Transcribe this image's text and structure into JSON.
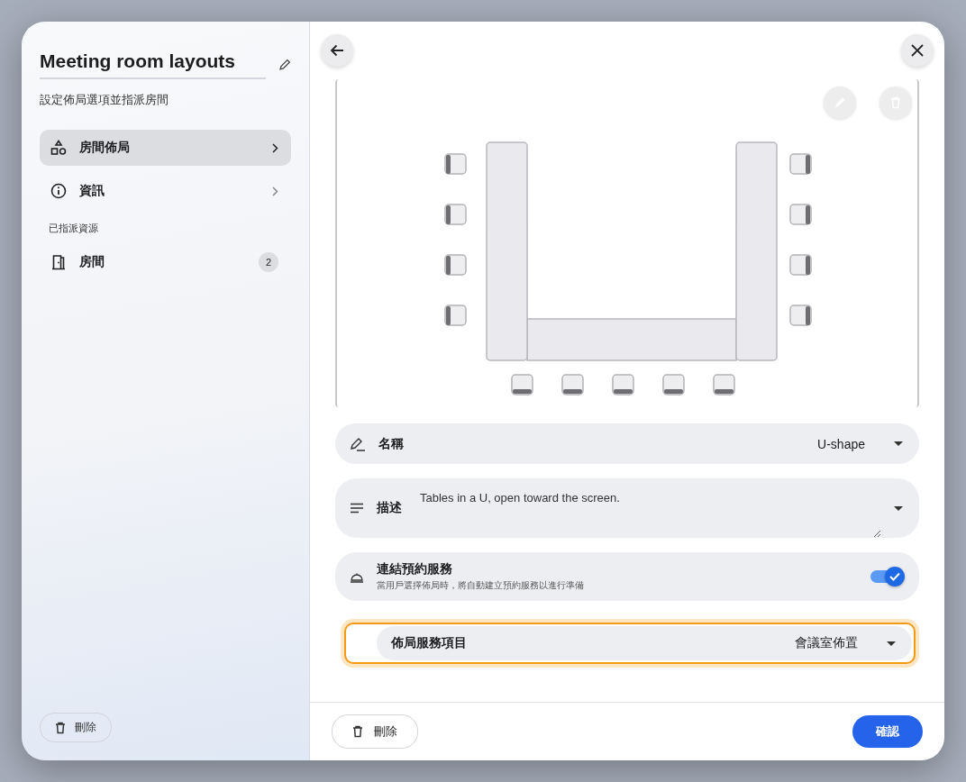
{
  "sidebar": {
    "title": "Meeting room layouts",
    "subtitle": "設定佈局選項並指派房間",
    "nav": [
      {
        "kind": "layout",
        "label": "房間佈局",
        "selected": true
      },
      {
        "kind": "info",
        "label": "資訊",
        "selected": false
      }
    ],
    "section_label": "已指派資源",
    "resources": [
      {
        "kind": "door",
        "label": "房間",
        "count": "2"
      }
    ],
    "delete_button": "刪除"
  },
  "form": {
    "name": {
      "label": "名稱",
      "value": "U-shape"
    },
    "description": {
      "label": "描述",
      "value": "Tables in a U, open toward the screen."
    },
    "link_service": {
      "label": "連結預約服務",
      "hint": "當用戶選擇佈局時，將自動建立預約服務以進行準備",
      "on": true
    },
    "service_item": {
      "label": "佈局服務項目",
      "value": "會議室佈置",
      "highlighted": true
    }
  },
  "footer": {
    "delete_button": "刪除",
    "confirm_button": "確認"
  }
}
